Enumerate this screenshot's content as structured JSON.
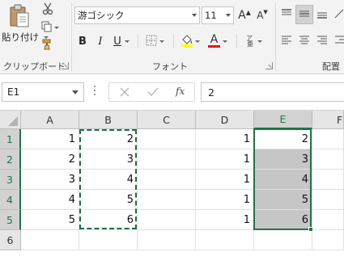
{
  "ribbon": {
    "clipboard": {
      "paste_label": "貼り付け",
      "group_label": "クリップボード"
    },
    "font": {
      "name": "游ゴシック",
      "size": "11",
      "bold": "B",
      "italic": "I",
      "underline": "U",
      "grow_label": "A",
      "shrink_label": "A",
      "group_label": "フォント",
      "font_color_label": "A",
      "highlight_color": "#ffff00",
      "font_color": "#ff0000"
    },
    "alignment": {
      "group_label": "配置"
    }
  },
  "formula_bar": {
    "name_box": "E1",
    "fx_label": "fx",
    "formula": "2"
  },
  "grid": {
    "columns": [
      "A",
      "B",
      "C",
      "D",
      "E",
      "F"
    ],
    "selected_column": "E",
    "rows": [
      "1",
      "2",
      "3",
      "4",
      "5",
      "6"
    ],
    "cells": [
      {
        "A": "1",
        "B": "2",
        "C": "",
        "D": "1",
        "E": "2"
      },
      {
        "A": "2",
        "B": "3",
        "C": "",
        "D": "1",
        "E": "3"
      },
      {
        "A": "3",
        "B": "4",
        "C": "",
        "D": "1",
        "E": "4"
      },
      {
        "A": "4",
        "B": "5",
        "C": "",
        "D": "1",
        "E": "5"
      },
      {
        "A": "5",
        "B": "6",
        "C": "",
        "D": "1",
        "E": "6"
      },
      {
        "A": "",
        "B": "",
        "C": "",
        "D": "",
        "E": ""
      }
    ]
  },
  "colors": {
    "accent": "#217346",
    "selection_fill": "#c6c6c6",
    "header_bg": "#e6e6e6"
  }
}
